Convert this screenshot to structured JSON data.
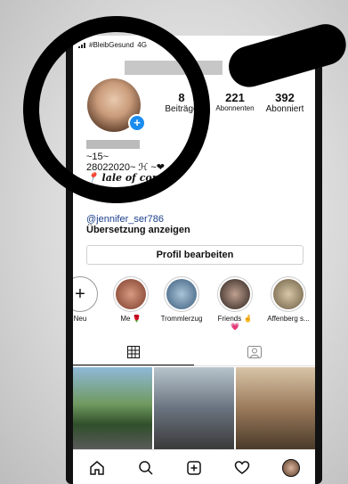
{
  "status": {
    "network_label": "#BleibGesund",
    "connection": "4G"
  },
  "profile": {
    "stats": [
      {
        "value": "8",
        "label": "Beiträge"
      },
      {
        "value": "221",
        "label": "Abonnenten"
      },
      {
        "value": "392",
        "label": "Abonniert"
      }
    ],
    "bio_lines": [
      "~15~",
      "28022020~ ℋ ~❤",
      "📍 lale of con⚓"
    ],
    "mention": "jennifer_ser786",
    "mention_prefix": "@",
    "translation_label": "Übersetzung anzeigen",
    "edit_profile_label": "Profil bearbeiten"
  },
  "highlights": [
    {
      "label": "Neu",
      "color": "#ffffff"
    },
    {
      "label": "Me 🌹",
      "color": "#b86a58"
    },
    {
      "label": "Trommlerzug",
      "color": "#6b8ca8"
    },
    {
      "label": "Friends 🤞💗",
      "color": "#5a4a44"
    },
    {
      "label": "Affenberg s...",
      "color": "#8a7a60"
    }
  ],
  "tabs": [
    "grid-icon",
    "tagged-icon"
  ],
  "bottom_nav": [
    "home-icon",
    "search-icon",
    "add-post-icon",
    "heart-icon",
    "profile-avatar"
  ],
  "colors": {
    "link": "#1a3e8a",
    "accent_blue": "#1a8cf0"
  }
}
